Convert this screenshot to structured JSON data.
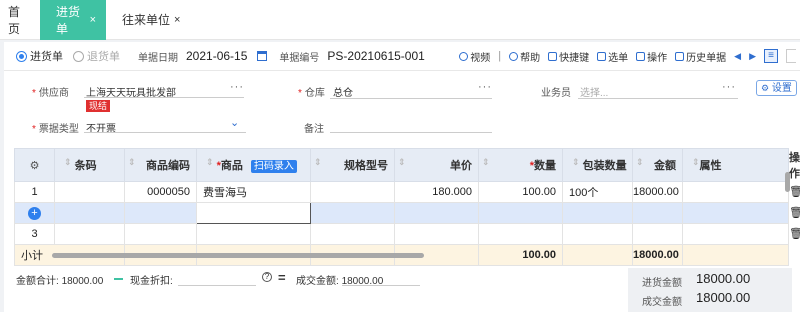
{
  "tabs": [
    {
      "label": "首页"
    },
    {
      "label": "进货单",
      "close": "×"
    },
    {
      "label": "往来单位",
      "close": "×"
    }
  ],
  "bill_type": {
    "option1": "进货单",
    "option2": "退货单"
  },
  "header": {
    "date_label": "单据日期",
    "date_value": "2021-06-15",
    "number_label": "单据编号",
    "number_value": "PS-20210615-001"
  },
  "toolbar": {
    "video": "视频",
    "help": "帮助",
    "shortcut": "快捷键",
    "select_bill": "选单",
    "operate": "操作",
    "history": "历史单据"
  },
  "form": {
    "supplier_label": "供应商",
    "supplier_value": "上海天天玩具批发部",
    "supplier_badge": "现结",
    "warehouse_label": "仓库",
    "warehouse_value": "总仓",
    "salesman_label": "业务员",
    "salesman_placeholder": "选择...",
    "invoice_label": "票据类型",
    "invoice_value": "不开票",
    "remark_label": "备注",
    "settings_button": "设置"
  },
  "table": {
    "headers": [
      "条码",
      "商品编码",
      "商品",
      "规格型号",
      "单价",
      "数量",
      "包装数量",
      "金额",
      "属性",
      "操作"
    ],
    "scan_button": "扫码录入",
    "rows": [
      {
        "no": "1",
        "barcode": "",
        "code": "0000050",
        "name": "费雪海马",
        "spec": "",
        "price": "180.000",
        "qty": "100.00",
        "pack": "100个",
        "amount": "18000.00",
        "attr": ""
      },
      {
        "no": "",
        "barcode": "",
        "code": "",
        "name": "",
        "spec": "",
        "price": "",
        "qty": "",
        "pack": "",
        "amount": "",
        "attr": ""
      },
      {
        "no": "3",
        "barcode": "",
        "code": "",
        "name": "",
        "spec": "",
        "price": "",
        "qty": "",
        "pack": "",
        "amount": "",
        "attr": ""
      }
    ],
    "subtotal_label": "小计",
    "subtotal_qty": "100.00",
    "subtotal_amount": "18000.00"
  },
  "footer": {
    "total_label": "金额合计:",
    "total_value": "18000.00",
    "cash_discount_label": "现金折扣:",
    "deal_label": "成交金额:",
    "deal_value": "18000.00"
  },
  "summary": {
    "purchase_label": "进货金额",
    "purchase_value": "18000.00",
    "deal_label": "成交金额",
    "deal_value": "18000.00"
  },
  "colors": {
    "accent": "#3fc2a3",
    "primary": "#2f80ed",
    "required": "#e02020"
  }
}
